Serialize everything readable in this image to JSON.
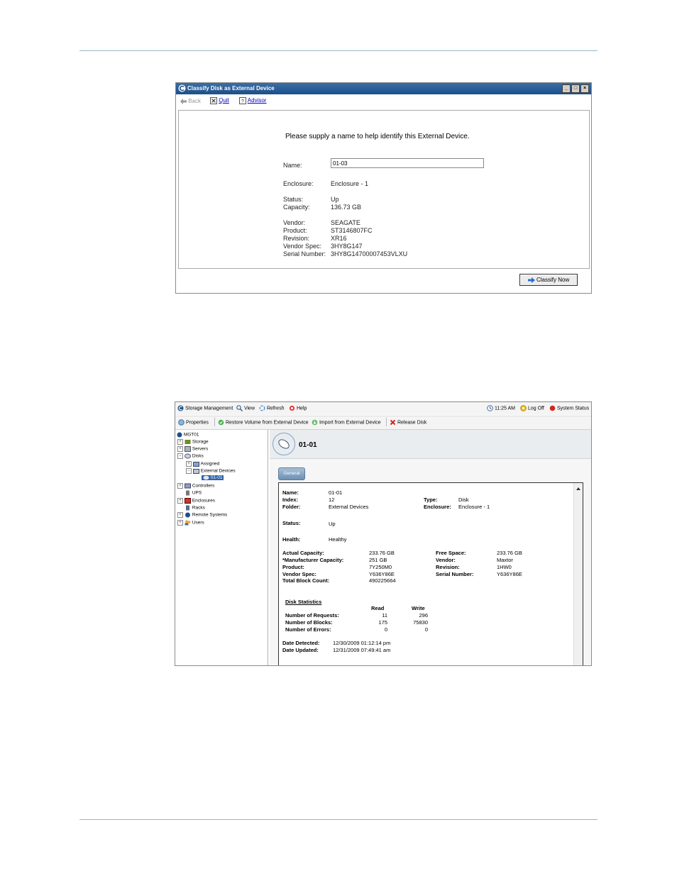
{
  "dialog": {
    "title": "Classify Disk as External Device",
    "toolbar": {
      "back": "Back",
      "quit": "Quit",
      "advisor": "Advisor"
    },
    "prompt": "Please supply a name to help identify this External Device.",
    "fields": {
      "name_label": "Name:",
      "name_value": "01-03",
      "enclosure_label": "Enclosure:",
      "enclosure_value": "Enclosure - 1",
      "status_label": "Status:",
      "status_value": "Up",
      "capacity_label": "Capacity:",
      "capacity_value": "136.73 GB",
      "vendor_label": "Vendor:",
      "vendor_value": "SEAGATE",
      "product_label": "Product:",
      "product_value": "ST3146807FC",
      "revision_label": "Revision:",
      "revision_value": "XR16",
      "vendorspec_label": "Vendor Spec:",
      "vendorspec_value": "3HY8G147",
      "serial_label": "Serial Number:",
      "serial_value": "3HY8G14700007453VLXU"
    },
    "classify_button": "Classify Now"
  },
  "app": {
    "menu": {
      "storage_management": "Storage Management",
      "view": "View",
      "refresh": "Refresh",
      "help": "Help",
      "time": "11:25 AM",
      "log_off": "Log Off",
      "system_status": "System Status"
    },
    "toolbar": {
      "properties": "Properties",
      "restore": "Restore Volume from External Device",
      "import": "Import from External Device",
      "release": "Release Disk"
    },
    "tree": {
      "root": "MGT01",
      "storage": "Storage",
      "servers": "Servers",
      "disks": "Disks",
      "assigned": "Assigned",
      "external_devices": "External Devices",
      "selected": "01-01",
      "controllers": "Controllers",
      "ups": "UPS",
      "enclosures": "Enclosures",
      "racks": "Racks",
      "remote_systems": "Remote Systems",
      "users": "Users"
    },
    "header_title": "01-01",
    "tab_general": "General",
    "details": {
      "name_label": "Name:",
      "name_value": "01-01",
      "index_label": "Index:",
      "index_value": "12",
      "folder_label": "Folder:",
      "folder_value": "External Devices",
      "type_label": "Type:",
      "type_value": "Disk",
      "enclosure_label": "Enclosure:",
      "enclosure_value": "Enclosure - 1",
      "status_label": "Status:",
      "status_value": "Up",
      "health_label": "Health:",
      "health_value": "Healthy",
      "actual_label": "Actual Capacity:",
      "actual_value": "233.76 GB",
      "mfr_label": "*Manufacturer Capacity:",
      "mfr_value": "251 GB",
      "product_label": "Product:",
      "product_value": "7Y250M0",
      "vspec_label": "Vendor Spec:",
      "vspec_value": "Y636Y86E",
      "blocks_label": "Total Block Count:",
      "blocks_value": "490225664",
      "free_label": "Free Space:",
      "free_value": "233.76 GB",
      "vendor_label": "Vendor:",
      "vendor_value": "Maxtor",
      "revision_label": "Revision:",
      "revision_value": "1HW0",
      "serial_label": "Serial Number:",
      "serial_value": "Y636Y86E"
    },
    "stats": {
      "title": "Disk Statistics",
      "col_read": "Read",
      "col_write": "Write",
      "rows": [
        {
          "label": "Number of Requests:",
          "read": "11",
          "write": "296"
        },
        {
          "label": "Number of Blocks:",
          "read": "175",
          "write": "75830"
        },
        {
          "label": "Number of Errors:",
          "read": "0",
          "write": "0"
        }
      ]
    },
    "dates": {
      "detected_label": "Date Detected:",
      "detected_value": "12/30/2009 01:12:14 pm",
      "updated_label": "Date Updated:",
      "updated_value": "12/31/2009 07:49:41 am"
    }
  }
}
